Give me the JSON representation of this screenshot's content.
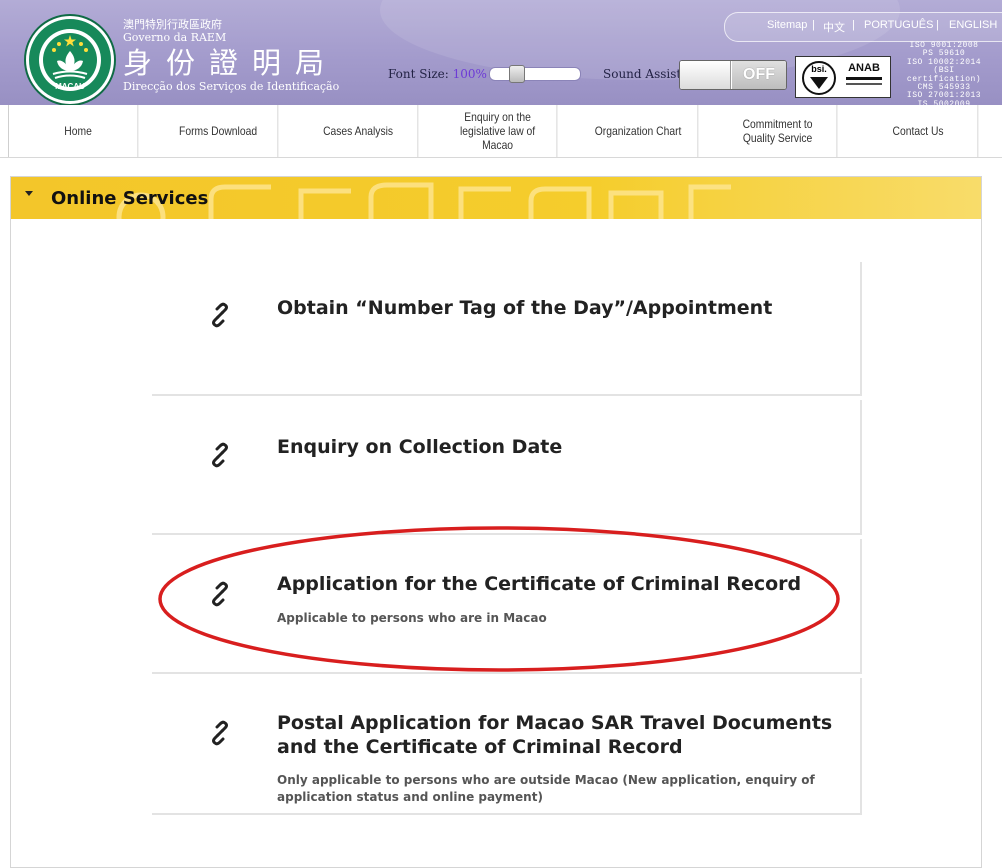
{
  "header": {
    "agency_line1": "澳門特別行政區政府",
    "agency_line2": "Governo da RAEM",
    "agency_big": "身份證明局",
    "agency_line3": "Direcção dos Serviços de Identificação",
    "emblem_text": "MACAU",
    "font_size_label": "Font Size:",
    "font_size_value": "100%",
    "font_size_level": 0.25,
    "sound_assist_label": "Sound Assist",
    "sound_assist_state": "OFF",
    "cert_bsi": "bsi.",
    "cert_anab": "ANAB",
    "iso_lines": [
      "ISO 9001:2008",
      "PS 59610",
      "ISO 10002:2014",
      "(BSI certification)",
      "CMS 545933",
      "ISO 27001:2013",
      "IS 5002009"
    ],
    "lang_links": [
      "Sitemap",
      "中文",
      "PORTUGUÊS",
      "ENGLISH"
    ],
    "lang_separator": "|",
    "header_color": "#a39bcc"
  },
  "nav": {
    "items": [
      {
        "label": "Home"
      },
      {
        "label": "Forms Download"
      },
      {
        "label": "Cases Analysis"
      },
      {
        "label": "Enquiry on the legislative law of Macao"
      },
      {
        "label": "Organization Chart"
      },
      {
        "label": "Commitment to Quality Service"
      },
      {
        "label": "Contact Us"
      }
    ]
  },
  "panel": {
    "title": "Online Services",
    "accent_color": "#f3c62a",
    "cards": [
      {
        "title": "Obtain “Number Tag of the Day”/Appointment",
        "subtitle": "",
        "icon": "link-icon"
      },
      {
        "title": "Enquiry on Collection Date",
        "subtitle": "",
        "icon": "link-icon"
      },
      {
        "title": "Application for the Certificate of Criminal Record",
        "subtitle": "Applicable to persons who are in Macao",
        "icon": "link-icon",
        "highlighted": true
      },
      {
        "title": "Postal Application for Macao SAR Travel Documents and the Certificate of Criminal Record",
        "subtitle": "Only applicable to persons who are outside Macao (New application, enquiry of application status and online payment)",
        "icon": "link-icon"
      }
    ],
    "highlight_color": "#d81e1e"
  }
}
